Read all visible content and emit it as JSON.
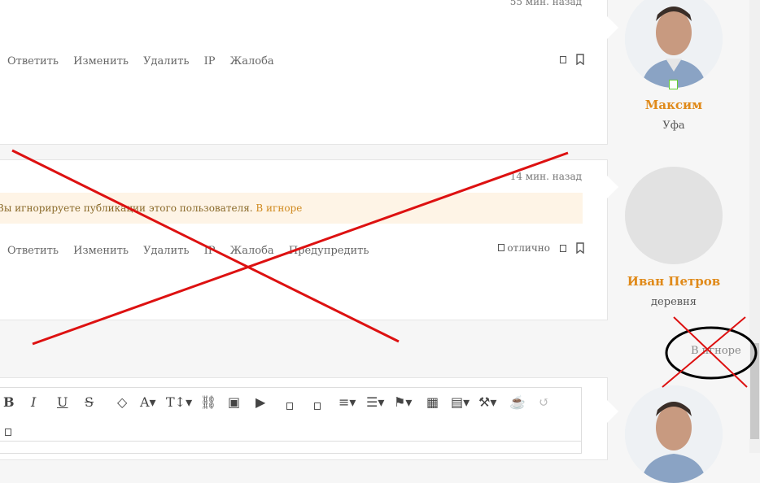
{
  "posts": [
    {
      "timestamp": "55 мин. назад",
      "actions": [
        "Ответить",
        "Изменить",
        "Удалить",
        "IP",
        "Жалоба"
      ]
    },
    {
      "timestamp": "14 мин. назад",
      "ignore_notice": "Вы игнорируете публикации этого пользователя.",
      "ignore_link": "В игноре",
      "actions": [
        "Ответить",
        "Изменить",
        "Удалить",
        "IP",
        "Жалоба",
        "Предупредить"
      ],
      "reaction": "отлично"
    }
  ],
  "users": [
    {
      "name": "Максим",
      "location": "Уфа"
    },
    {
      "name": "Иван Петров",
      "location": "деревня",
      "ignore_label": "В игноре"
    }
  ],
  "colors": {
    "accent": "#e08a1a",
    "annotation_red": "#dd1111",
    "annotation_black": "#000000"
  }
}
